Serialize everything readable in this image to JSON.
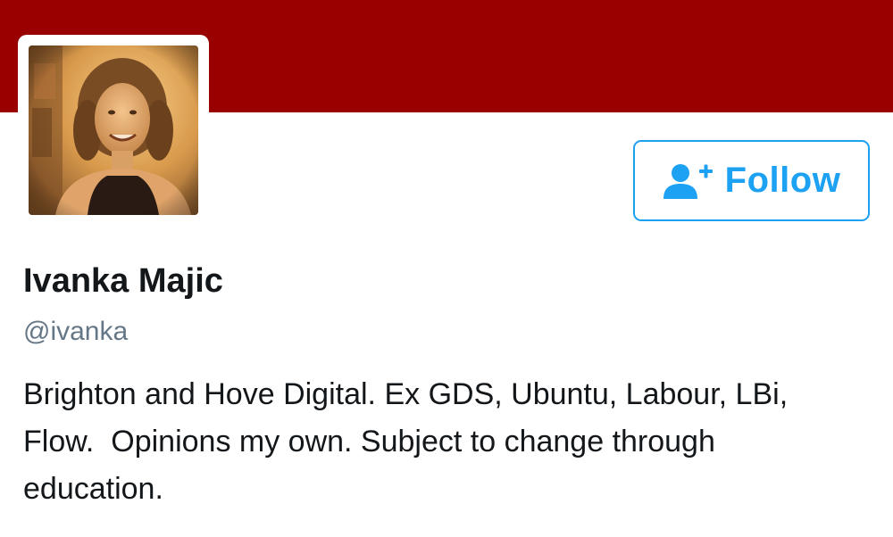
{
  "header": {
    "banner_color": "#990000"
  },
  "profile": {
    "display_name": "Ivanka Majic",
    "handle": "@ivanka",
    "bio": "Brighton and Hove Digital. Ex GDS, Ubuntu, Labour, LBi,\nFlow.  Opinions my own. Subject to change through\neducation."
  },
  "follow_button": {
    "label": "Follow",
    "icon": "follow-user-plus-icon",
    "accent_color": "#1da1f2"
  },
  "avatar": {
    "icon": "profile-photo"
  }
}
